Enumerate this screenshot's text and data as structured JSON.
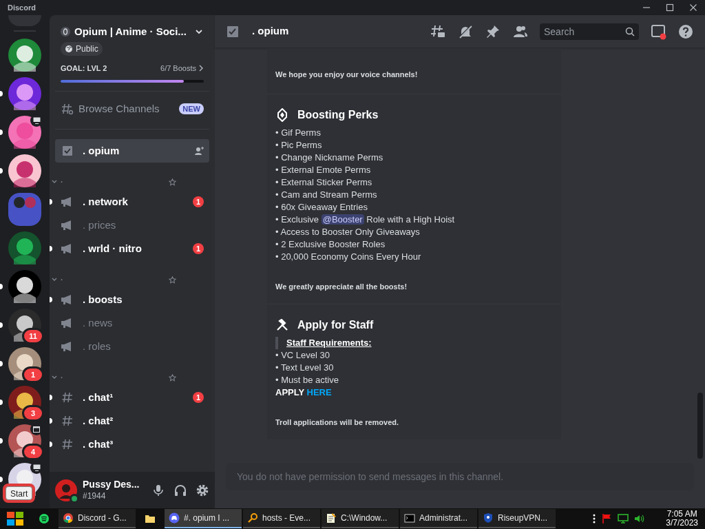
{
  "window": {
    "title": "Discord"
  },
  "servers": [
    {
      "kind": "server",
      "unread": false
    },
    {
      "kind": "server",
      "unread": true
    },
    {
      "kind": "server",
      "unread": true,
      "streaming": true
    },
    {
      "kind": "server",
      "unread": true
    },
    {
      "kind": "folder",
      "unread": false
    },
    {
      "kind": "server",
      "unread": false
    },
    {
      "kind": "server",
      "unread": true
    },
    {
      "kind": "server",
      "unread": true,
      "badge": "11"
    },
    {
      "kind": "server",
      "unread": true,
      "badge": "1"
    },
    {
      "kind": "server",
      "unread": true,
      "badge": "3"
    },
    {
      "kind": "server",
      "unread": true,
      "badge": "4",
      "has_event": true
    },
    {
      "kind": "server",
      "unread": true,
      "streaming": true
    }
  ],
  "start_tooltip": "Start",
  "server": {
    "name": "Opium | Anime · Soci...",
    "visibility": "Public",
    "goal": "GOAL: LVL 2",
    "boosts": "6/7 Boosts",
    "level": 0.86
  },
  "browse": {
    "label": "Browse Channels",
    "badge": "NEW"
  },
  "channels": [
    {
      "kind": "rules",
      "name": ". opium",
      "selected": true,
      "unread": false
    },
    {
      "kind": "category",
      "name": "·",
      "expanded": true,
      "children": [
        {
          "kind": "announcement",
          "name": ". network",
          "selected": false,
          "unread": true,
          "badge": "1"
        },
        {
          "kind": "announcement",
          "name": ". prices",
          "selected": false,
          "unread": false
        },
        {
          "kind": "announcement",
          "name": ". wrld · nitro",
          "selected": false,
          "unread": true,
          "badge": "1"
        }
      ]
    },
    {
      "kind": "category",
      "name": "·",
      "expanded": true,
      "children": [
        {
          "kind": "announcement",
          "name": ". boosts",
          "selected": false,
          "unread": true
        },
        {
          "kind": "announcement",
          "name": ". news",
          "selected": false,
          "unread": false
        },
        {
          "kind": "announcement",
          "name": ". roles",
          "selected": false,
          "unread": false
        }
      ]
    },
    {
      "kind": "category",
      "name": "·",
      "expanded": true,
      "children": [
        {
          "kind": "text",
          "name": ". chat¹",
          "selected": false,
          "unread": true,
          "badge": "1"
        },
        {
          "kind": "text",
          "name": ". chat²",
          "selected": false,
          "unread": true
        },
        {
          "kind": "text",
          "name": ". chat³",
          "selected": false,
          "unread": true
        }
      ]
    }
  ],
  "user": {
    "name": "Pussy Des...",
    "tag": "#1944",
    "online": true
  },
  "header": {
    "channel": ". opium",
    "search": {
      "placeholder": "Search"
    },
    "inbox_unread": true
  },
  "sections": [
    {
      "kind": "plain",
      "footer": "We hope you enjoy our voice channels!"
    },
    {
      "kind": "perks",
      "title": "Boosting Perks",
      "items": [
        {
          "text": "• Gif Perms"
        },
        {
          "text": "• Pic Perms"
        },
        {
          "text": "• Change Nickname Perms"
        },
        {
          "text": "• External Emote Perms"
        },
        {
          "text": "• External Sticker Perms"
        },
        {
          "text": "• Cam and Stream Perms"
        },
        {
          "text": "• 60x Giveaway Entries"
        },
        {
          "text": "• Exclusive ",
          "mention": "@Booster",
          "after": " Role with a High Hoist"
        },
        {
          "text": "• Access to Booster Only Giveaways"
        },
        {
          "text": "• 2 Exclusive Booster Roles"
        },
        {
          "text": "• 20,000 Economy Coins Every Hour"
        }
      ],
      "footer": "We greatly appreciate all the boosts!"
    },
    {
      "kind": "staff",
      "title": "Apply for Staff",
      "quote": "Staff Requirements:",
      "items": [
        {
          "text": "• VC Level 30"
        },
        {
          "text": "• Text Level 30"
        },
        {
          "text": "• Must be active"
        }
      ],
      "apply": {
        "text": "APPLY",
        "link": "HERE"
      },
      "footer": "Troll applications will be removed."
    }
  ],
  "composer": {
    "placeholder": "You do not have permission to send messages in this channel."
  },
  "taskbar": {
    "items": [
      {
        "kind": "spotify"
      },
      {
        "kind": "chrome",
        "label": "Discord - G...",
        "selected": false
      },
      {
        "kind": "folder"
      },
      {
        "kind": "discord",
        "label": "#. opium I ...",
        "selected": true
      },
      {
        "kind": "search",
        "label": "hosts - Eve...",
        "selected": false
      },
      {
        "kind": "notepad",
        "label": "C:\\Window...",
        "selected": false
      },
      {
        "kind": "cmd",
        "label": "Administrat...",
        "selected": false
      },
      {
        "kind": "vpn",
        "label": "RiseupVPN...",
        "selected": false
      }
    ],
    "time": "7:05 AM",
    "date": "3/7/2023"
  }
}
